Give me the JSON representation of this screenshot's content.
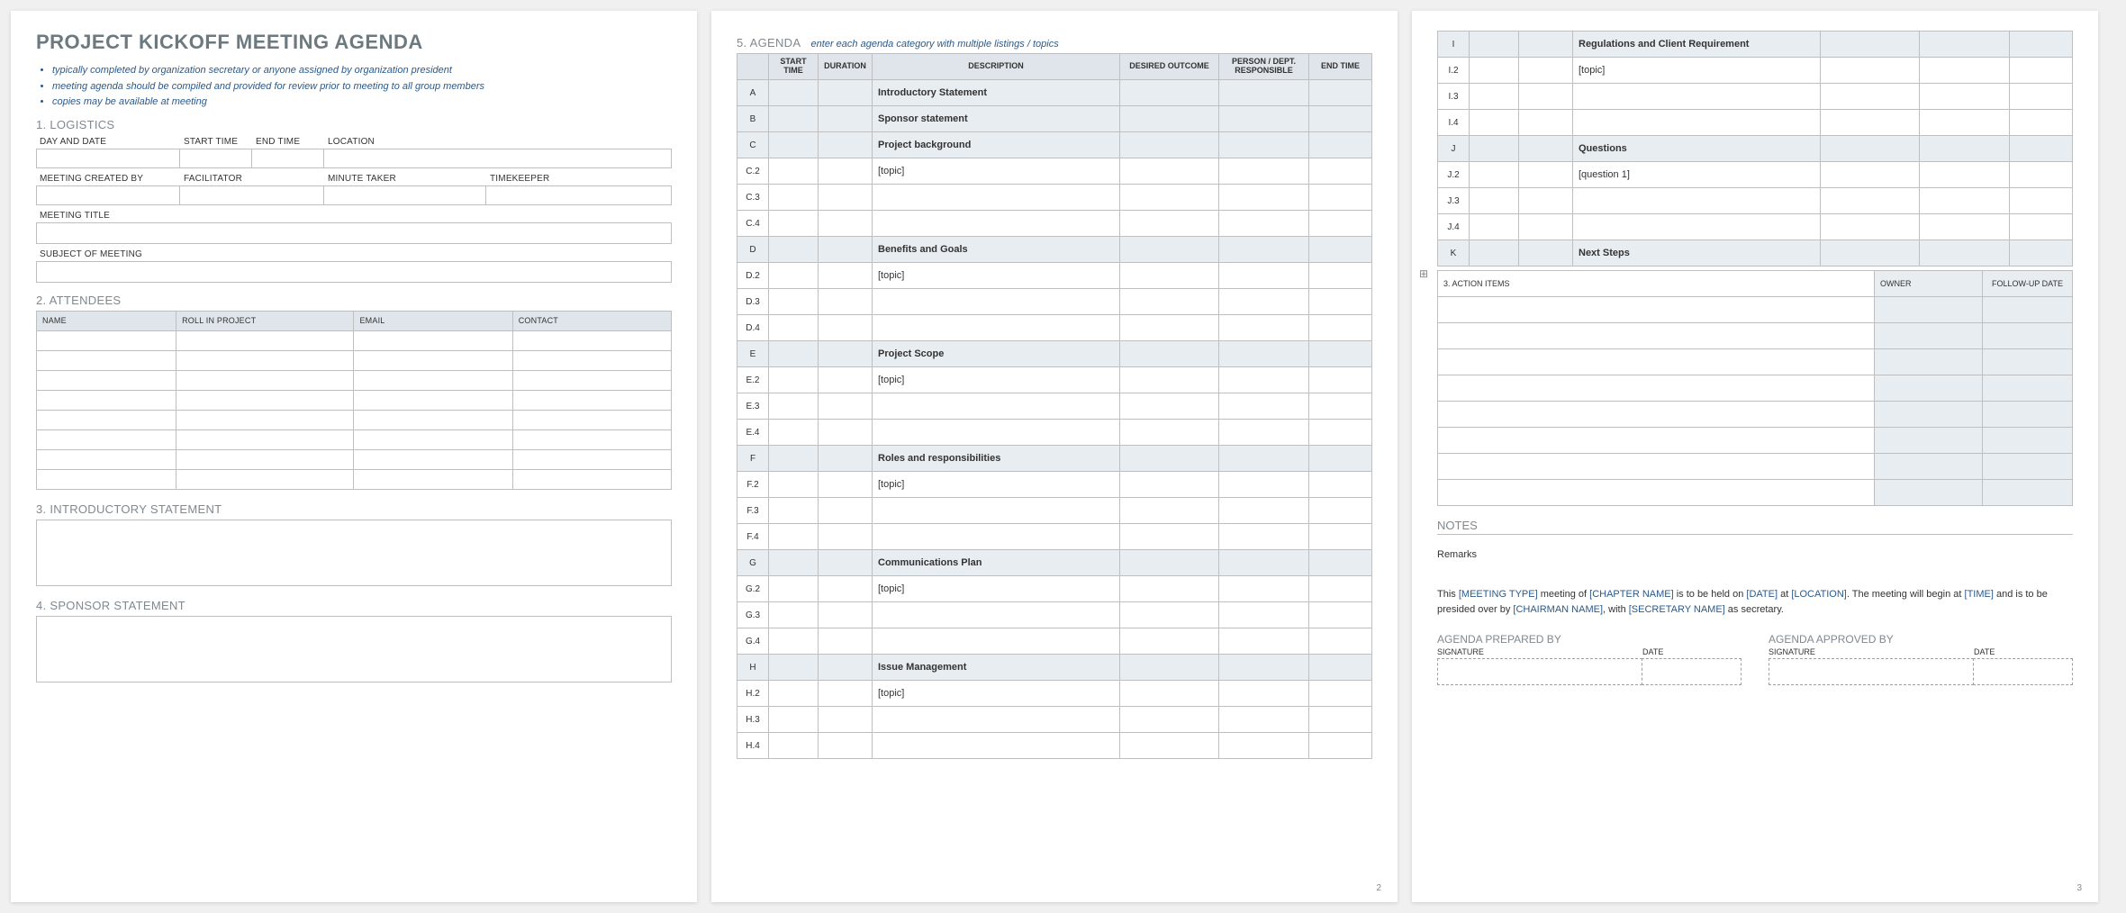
{
  "title": "PROJECT KICKOFF MEETING AGENDA",
  "bullets": [
    "typically completed by organization secretary or anyone assigned by organization president",
    "meeting agenda should be compiled and provided for review prior to meeting to all group members",
    "copies may be available at meeting"
  ],
  "sections": {
    "logistics": "1. LOGISTICS",
    "attendees": "2. ATTENDEES",
    "intro": "3. INTRODUCTORY STATEMENT",
    "sponsor": "4. SPONSOR STATEMENT",
    "agenda": "5. AGENDA",
    "agenda_hint": "enter each agenda category with multiple listings / topics",
    "action": "3. ACTION ITEMS",
    "notes": "NOTES",
    "prepared": "AGENDA PREPARED BY",
    "approved": "AGENDA APPROVED BY"
  },
  "logistics_labels": {
    "day_date": "DAY AND DATE",
    "start_time": "START TIME",
    "end_time": "END TIME",
    "location": "LOCATION",
    "created_by": "MEETING CREATED BY",
    "facilitator": "FACILITATOR",
    "minute_taker": "MINUTE TAKER",
    "timekeeper": "TIMEKEEPER",
    "meeting_title": "MEETING TITLE",
    "subject": "SUBJECT OF MEETING"
  },
  "attendees_headers": [
    "NAME",
    "ROLL IN PROJECT",
    "EMAIL",
    "CONTACT"
  ],
  "agenda_headers": [
    "",
    "START TIME",
    "DURATION",
    "DESCRIPTION",
    "DESIRED OUTCOME",
    "PERSON / DEPT. RESPONSIBLE",
    "END TIME"
  ],
  "agenda_rows_p2": [
    {
      "id": "A",
      "desc": "Introductory Statement",
      "parent": true
    },
    {
      "id": "B",
      "desc": "Sponsor statement",
      "parent": true
    },
    {
      "id": "C",
      "desc": "Project background",
      "parent": true
    },
    {
      "id": "C.2",
      "desc": "[topic]",
      "parent": false
    },
    {
      "id": "C.3",
      "desc": "",
      "parent": false
    },
    {
      "id": "C.4",
      "desc": "",
      "parent": false
    },
    {
      "id": "D",
      "desc": "Benefits and Goals",
      "parent": true
    },
    {
      "id": "D.2",
      "desc": "[topic]",
      "parent": false
    },
    {
      "id": "D.3",
      "desc": "",
      "parent": false
    },
    {
      "id": "D.4",
      "desc": "",
      "parent": false
    },
    {
      "id": "E",
      "desc": "Project Scope",
      "parent": true
    },
    {
      "id": "E.2",
      "desc": "[topic]",
      "parent": false
    },
    {
      "id": "E.3",
      "desc": "",
      "parent": false
    },
    {
      "id": "E.4",
      "desc": "",
      "parent": false
    },
    {
      "id": "F",
      "desc": "Roles and responsibilities",
      "parent": true
    },
    {
      "id": "F.2",
      "desc": "[topic]",
      "parent": false
    },
    {
      "id": "F.3",
      "desc": "",
      "parent": false
    },
    {
      "id": "F.4",
      "desc": "",
      "parent": false
    },
    {
      "id": "G",
      "desc": "Communications Plan",
      "parent": true
    },
    {
      "id": "G.2",
      "desc": "[topic]",
      "parent": false
    },
    {
      "id": "G.3",
      "desc": "",
      "parent": false
    },
    {
      "id": "G.4",
      "desc": "",
      "parent": false
    },
    {
      "id": "H",
      "desc": "Issue Management",
      "parent": true
    },
    {
      "id": "H.2",
      "desc": "[topic]",
      "parent": false
    },
    {
      "id": "H.3",
      "desc": "",
      "parent": false
    },
    {
      "id": "H.4",
      "desc": "",
      "parent": false
    }
  ],
  "agenda_rows_p3": [
    {
      "id": "I",
      "desc": "Regulations and Client Requirement",
      "parent": true
    },
    {
      "id": "I.2",
      "desc": "[topic]",
      "parent": false
    },
    {
      "id": "I.3",
      "desc": "",
      "parent": false
    },
    {
      "id": "I.4",
      "desc": "",
      "parent": false
    },
    {
      "id": "J",
      "desc": "Questions",
      "parent": true
    },
    {
      "id": "J.2",
      "desc": "[question 1]",
      "parent": false
    },
    {
      "id": "J.3",
      "desc": "",
      "parent": false
    },
    {
      "id": "J.4",
      "desc": "",
      "parent": false
    },
    {
      "id": "K",
      "desc": "Next Steps",
      "parent": true
    }
  ],
  "action_headers": {
    "owner": "OWNER",
    "followup": "FOLLOW-UP DATE"
  },
  "remarks_label": "Remarks",
  "sentence": {
    "t0": "This ",
    "p0": "[MEETING TYPE]",
    "t1": " meeting of ",
    "p1": "[CHAPTER NAME]",
    "t2": " is to be held on ",
    "p2": "[DATE]",
    "t3": " at ",
    "p3": "[LOCATION]",
    "t4": ".  The meeting will begin at ",
    "p4": "[TIME]",
    "t5": " and is to be presided over by ",
    "p5": "[CHAIRMAN NAME]",
    "t6": ", with ",
    "p6": "[SECRETARY NAME]",
    "t7": " as secretary."
  },
  "sig_labels": {
    "signature": "SIGNATURE",
    "date": "DATE"
  },
  "page_numbers": {
    "p2": "2",
    "p3": "3"
  }
}
